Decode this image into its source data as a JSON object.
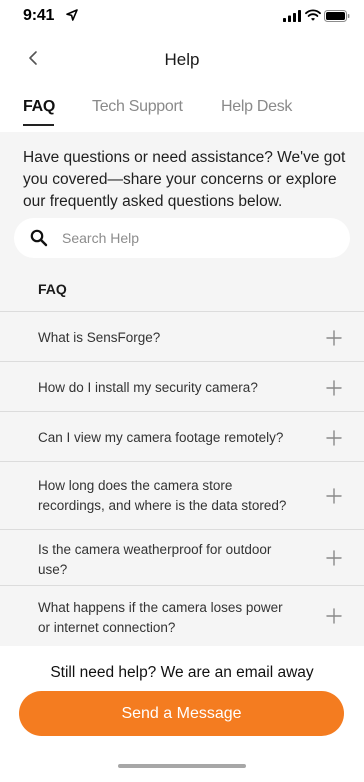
{
  "status_bar": {
    "time": "9:41"
  },
  "header": {
    "title": "Help"
  },
  "tabs": [
    {
      "label": "FAQ",
      "active": true
    },
    {
      "label": "Tech Support",
      "active": false
    },
    {
      "label": "Help Desk",
      "active": false
    }
  ],
  "intro": "Have questions or need assistance? We've got you covered—share your concerns or explore our frequently asked questions below.",
  "search": {
    "placeholder": "Search Help"
  },
  "faq": {
    "heading": "FAQ",
    "items": [
      {
        "question": "What is SensForge?"
      },
      {
        "question": "How do I install my security camera?"
      },
      {
        "question": "Can I view my camera footage remotely?"
      },
      {
        "question": "How long does the camera store recordings, and where is the data stored?"
      },
      {
        "question": "Is the camera weatherproof for outdoor use?"
      },
      {
        "question": "What happens if the camera loses power or internet connection?"
      }
    ]
  },
  "footer": {
    "text": "Still need help? We are an email away",
    "button_label": "Send a Message"
  },
  "colors": {
    "accent": "#f47c20",
    "background": "#f5f5f5",
    "surface": "#ffffff",
    "divider": "#dcdcdc"
  },
  "icons": {
    "back": "chevron-left-icon",
    "search": "search-icon",
    "expand": "plus-icon"
  }
}
